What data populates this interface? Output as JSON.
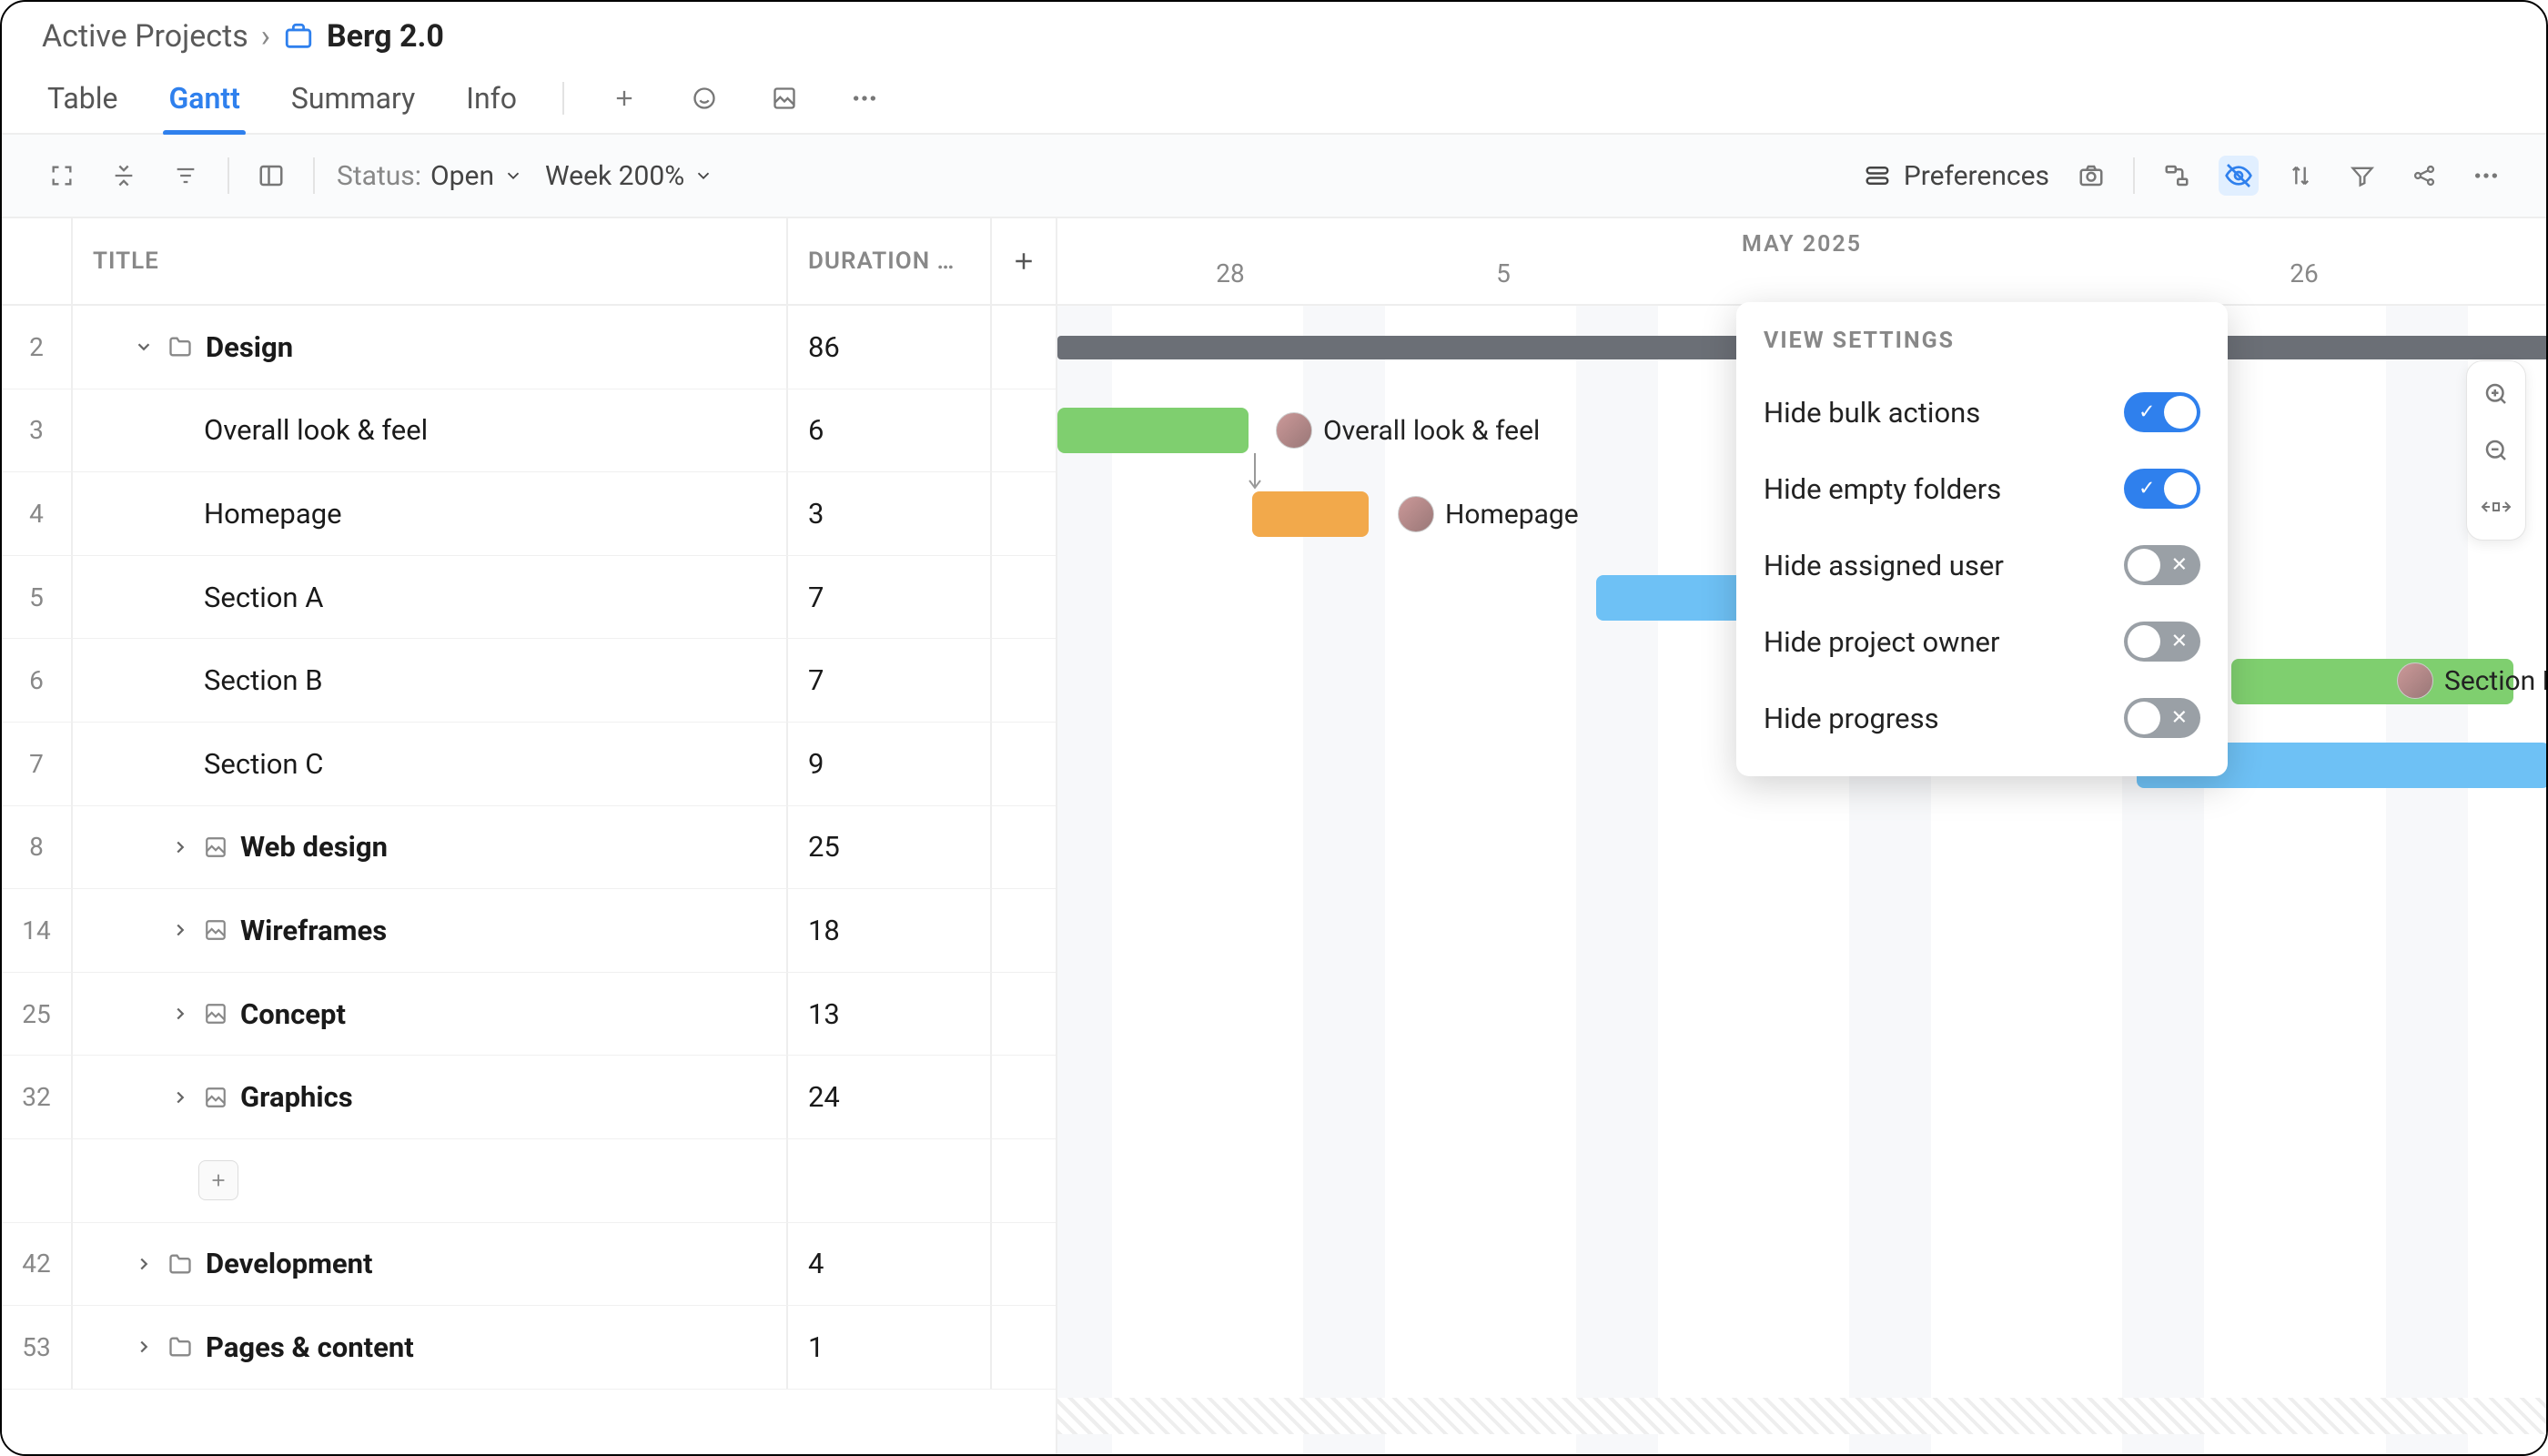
{
  "breadcrumb": {
    "parent": "Active Projects",
    "title": "Berg 2.0"
  },
  "tabs": {
    "table": "Table",
    "gantt": "Gantt",
    "summary": "Summary",
    "info": "Info"
  },
  "toolbar": {
    "status_label": "Status:",
    "status_value": "Open",
    "zoom_value": "Week 200%",
    "preferences": "Preferences"
  },
  "columns": {
    "title": "TITLE",
    "duration": "DURATION …"
  },
  "timeline": {
    "month": "MAY 2025",
    "days": [
      "28",
      "5",
      "26"
    ]
  },
  "rows": [
    {
      "num": "2",
      "title": "Design",
      "dur": "86",
      "type": "folder",
      "exp": true,
      "bold": true
    },
    {
      "num": "3",
      "title": "Overall look & feel",
      "dur": "6",
      "type": "task"
    },
    {
      "num": "4",
      "title": "Homepage",
      "dur": "3",
      "type": "task"
    },
    {
      "num": "5",
      "title": "Section A",
      "dur": "7",
      "type": "task"
    },
    {
      "num": "6",
      "title": "Section B",
      "dur": "7",
      "type": "task"
    },
    {
      "num": "7",
      "title": "Section C",
      "dur": "9",
      "type": "task"
    },
    {
      "num": "8",
      "title": "Web design",
      "dur": "25",
      "type": "subfolder",
      "bold": true
    },
    {
      "num": "14",
      "title": "Wireframes",
      "dur": "18",
      "type": "subfolder",
      "bold": true
    },
    {
      "num": "25",
      "title": "Concept",
      "dur": "13",
      "type": "subfolder",
      "bold": true
    },
    {
      "num": "32",
      "title": "Graphics",
      "dur": "24",
      "type": "subfolder",
      "bold": true
    },
    {
      "num": "",
      "title": "",
      "dur": "",
      "type": "add"
    },
    {
      "num": "42",
      "title": "Development",
      "dur": "4",
      "type": "folder",
      "bold": true
    },
    {
      "num": "53",
      "title": "Pages & content",
      "dur": "1",
      "type": "folder",
      "bold": true
    }
  ],
  "bars": {
    "overall": "Overall look & feel",
    "homepage": "Homepage",
    "sectionb": "Section B"
  },
  "popover": {
    "heading": "VIEW SETTINGS",
    "items": [
      {
        "label": "Hide bulk actions",
        "on": true
      },
      {
        "label": "Hide empty folders",
        "on": true
      },
      {
        "label": "Hide assigned user",
        "on": false
      },
      {
        "label": "Hide project owner",
        "on": false
      },
      {
        "label": "Hide progress",
        "on": false
      }
    ]
  }
}
